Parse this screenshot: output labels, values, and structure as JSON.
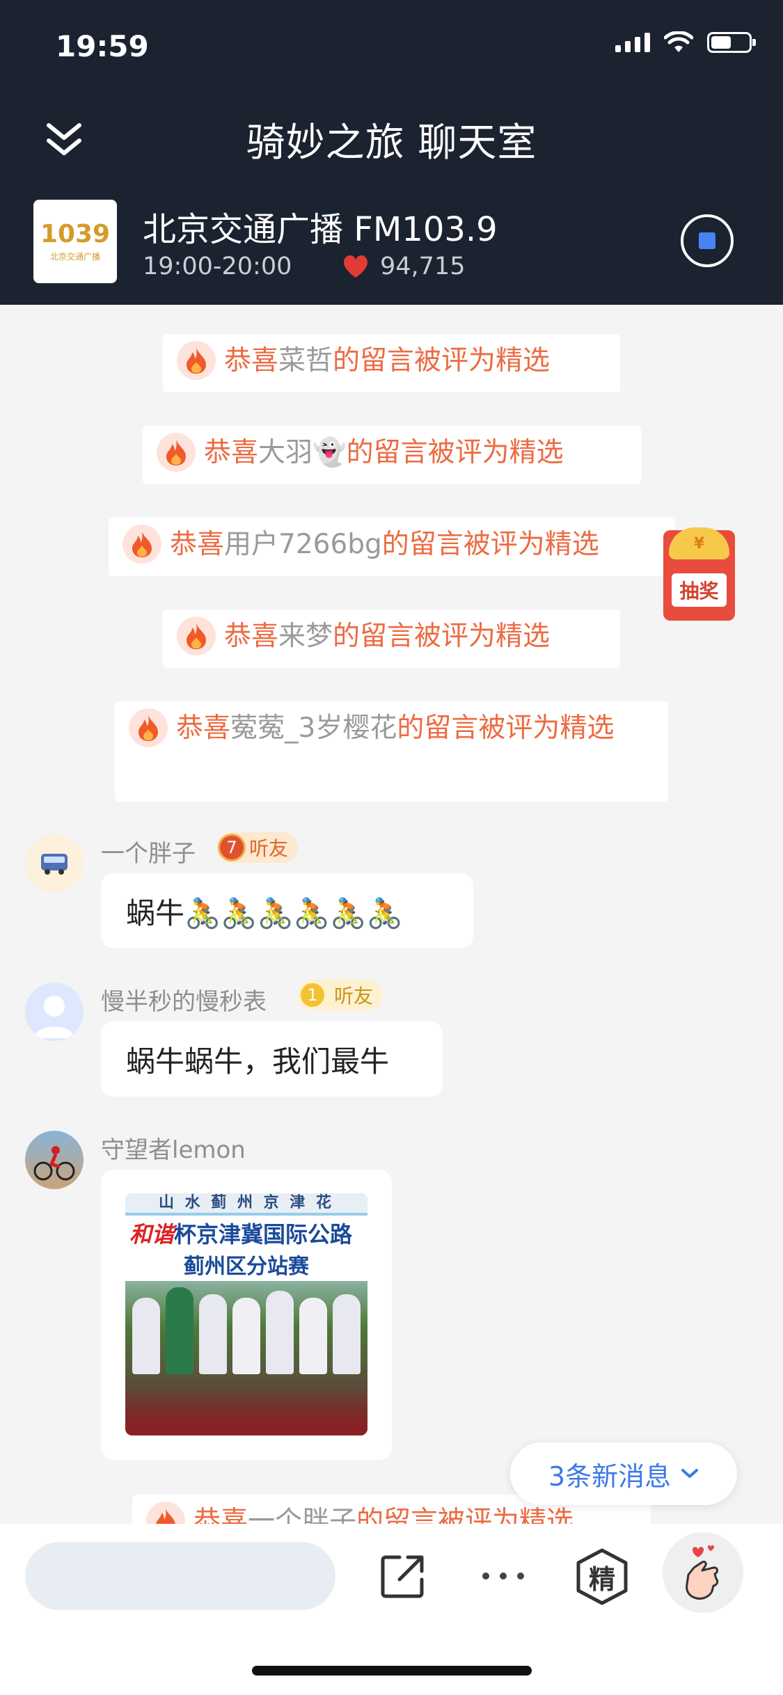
{
  "status_bar": {
    "time": "19:59"
  },
  "header": {
    "title": "骑妙之旅 聊天室",
    "station": {
      "logo_number": "1039",
      "logo_caption": "北京交通广播",
      "name": "北京交通广播 FM103.9",
      "time_range": "19:00-20:00",
      "likes": "94,715"
    }
  },
  "notices": [
    {
      "prefix": "恭喜",
      "name": "菜哲",
      "suffix": "的留言被评为精选"
    },
    {
      "prefix": "恭喜",
      "name": "大羽👻",
      "suffix": "的留言被评为精选"
    },
    {
      "prefix": "恭喜",
      "name": "用户7266bg",
      "suffix": "的留言被评为精选"
    },
    {
      "prefix": "恭喜",
      "name": "来梦",
      "suffix": "的留言被评为精选"
    },
    {
      "prefix": "恭喜",
      "name": "蒬蒬_3岁樱花",
      "suffix": "的留言被评为精选"
    },
    {
      "prefix": "恭喜",
      "name": "一个胖子",
      "suffix": "的留言被评为精选"
    }
  ],
  "lottery": {
    "label": "抽奖",
    "coin": "¥"
  },
  "messages": [
    {
      "user": "一个胖子",
      "badge_level": "7",
      "badge_label": "听友",
      "text": "蜗牛🚴🚴🚴🚴🚴🚴"
    },
    {
      "user": "慢半秒的慢秒表",
      "badge_level": "1",
      "badge_label": "听友",
      "text": "蜗牛蜗牛，我们最牛"
    },
    {
      "user": "守望者lemon",
      "image": {
        "banner_line1": "山 水 蓟 州 京 津 花",
        "banner_line2_red": "和谐",
        "banner_line2": "杯京津冀国际公路",
        "banner_line3": "蓟州区分站赛"
      }
    }
  ],
  "new_messages_label": "3条新消息",
  "toolbar": {
    "featured_label": "精"
  },
  "colors": {
    "header_bg": "#1b2230",
    "accent_orange": "#ec6b42",
    "link_blue": "#3d78e8"
  }
}
